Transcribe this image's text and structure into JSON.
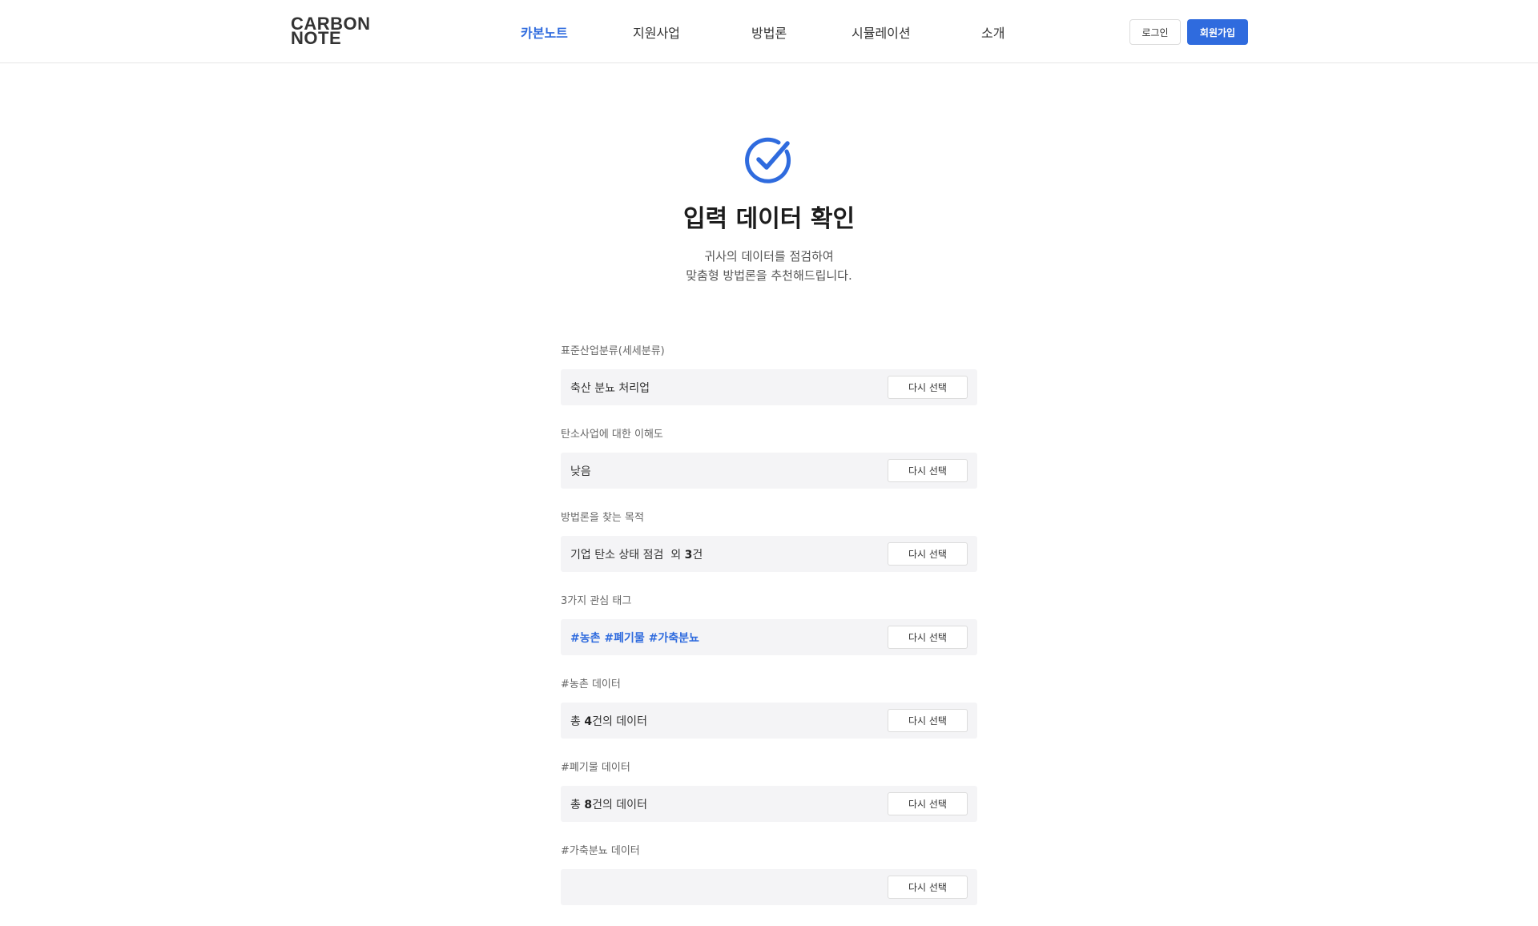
{
  "header": {
    "logo_line1": "CARBON",
    "logo_line2": "NOTE",
    "nav": [
      {
        "label": "카본노트",
        "active": true
      },
      {
        "label": "지원사업",
        "active": false
      },
      {
        "label": "방법론",
        "active": false
      },
      {
        "label": "시뮬레이션",
        "active": false
      },
      {
        "label": "소개",
        "active": false
      }
    ],
    "login_label": "로그인",
    "signup_label": "회원가입"
  },
  "hero": {
    "icon": "check-circle-icon",
    "title": "입력 데이터 확인",
    "subtitle_line1": "귀사의 데이터를 점검하여",
    "subtitle_line2": "맞춤형 방법론을 추천해드립니다."
  },
  "fields": [
    {
      "label": "표준산업분류(세세분류)",
      "value": "축산 분뇨 처리업",
      "button": "다시 선택"
    },
    {
      "label": "탄소사업에 대한 이해도",
      "value": "낮음",
      "button": "다시 선택"
    },
    {
      "label": "방법론을 찾는 목적",
      "value_prefix": "기업 탄소 상태 점검  외 ",
      "value_bold": "3",
      "value_suffix": "건",
      "button": "다시 선택"
    },
    {
      "label": "3가지 관심 태그",
      "value": "#농촌 #폐기물 #가축분뇨",
      "button": "다시 선택"
    },
    {
      "label": "#농촌 데이터",
      "value_prefix": "총 ",
      "value_bold": "4",
      "value_suffix": "건의 데이터",
      "button": "다시 선택"
    },
    {
      "label": "#폐기물 데이터",
      "value_prefix": "총 ",
      "value_bold": "8",
      "value_suffix": "건의 데이터",
      "button": "다시 선택"
    },
    {
      "label": "#가축분뇨 데이터",
      "value": "",
      "button": "다시 선택"
    }
  ],
  "colors": {
    "accent": "#2f6bde",
    "field_bg": "#f4f4f6",
    "border": "#dcdcdc"
  }
}
